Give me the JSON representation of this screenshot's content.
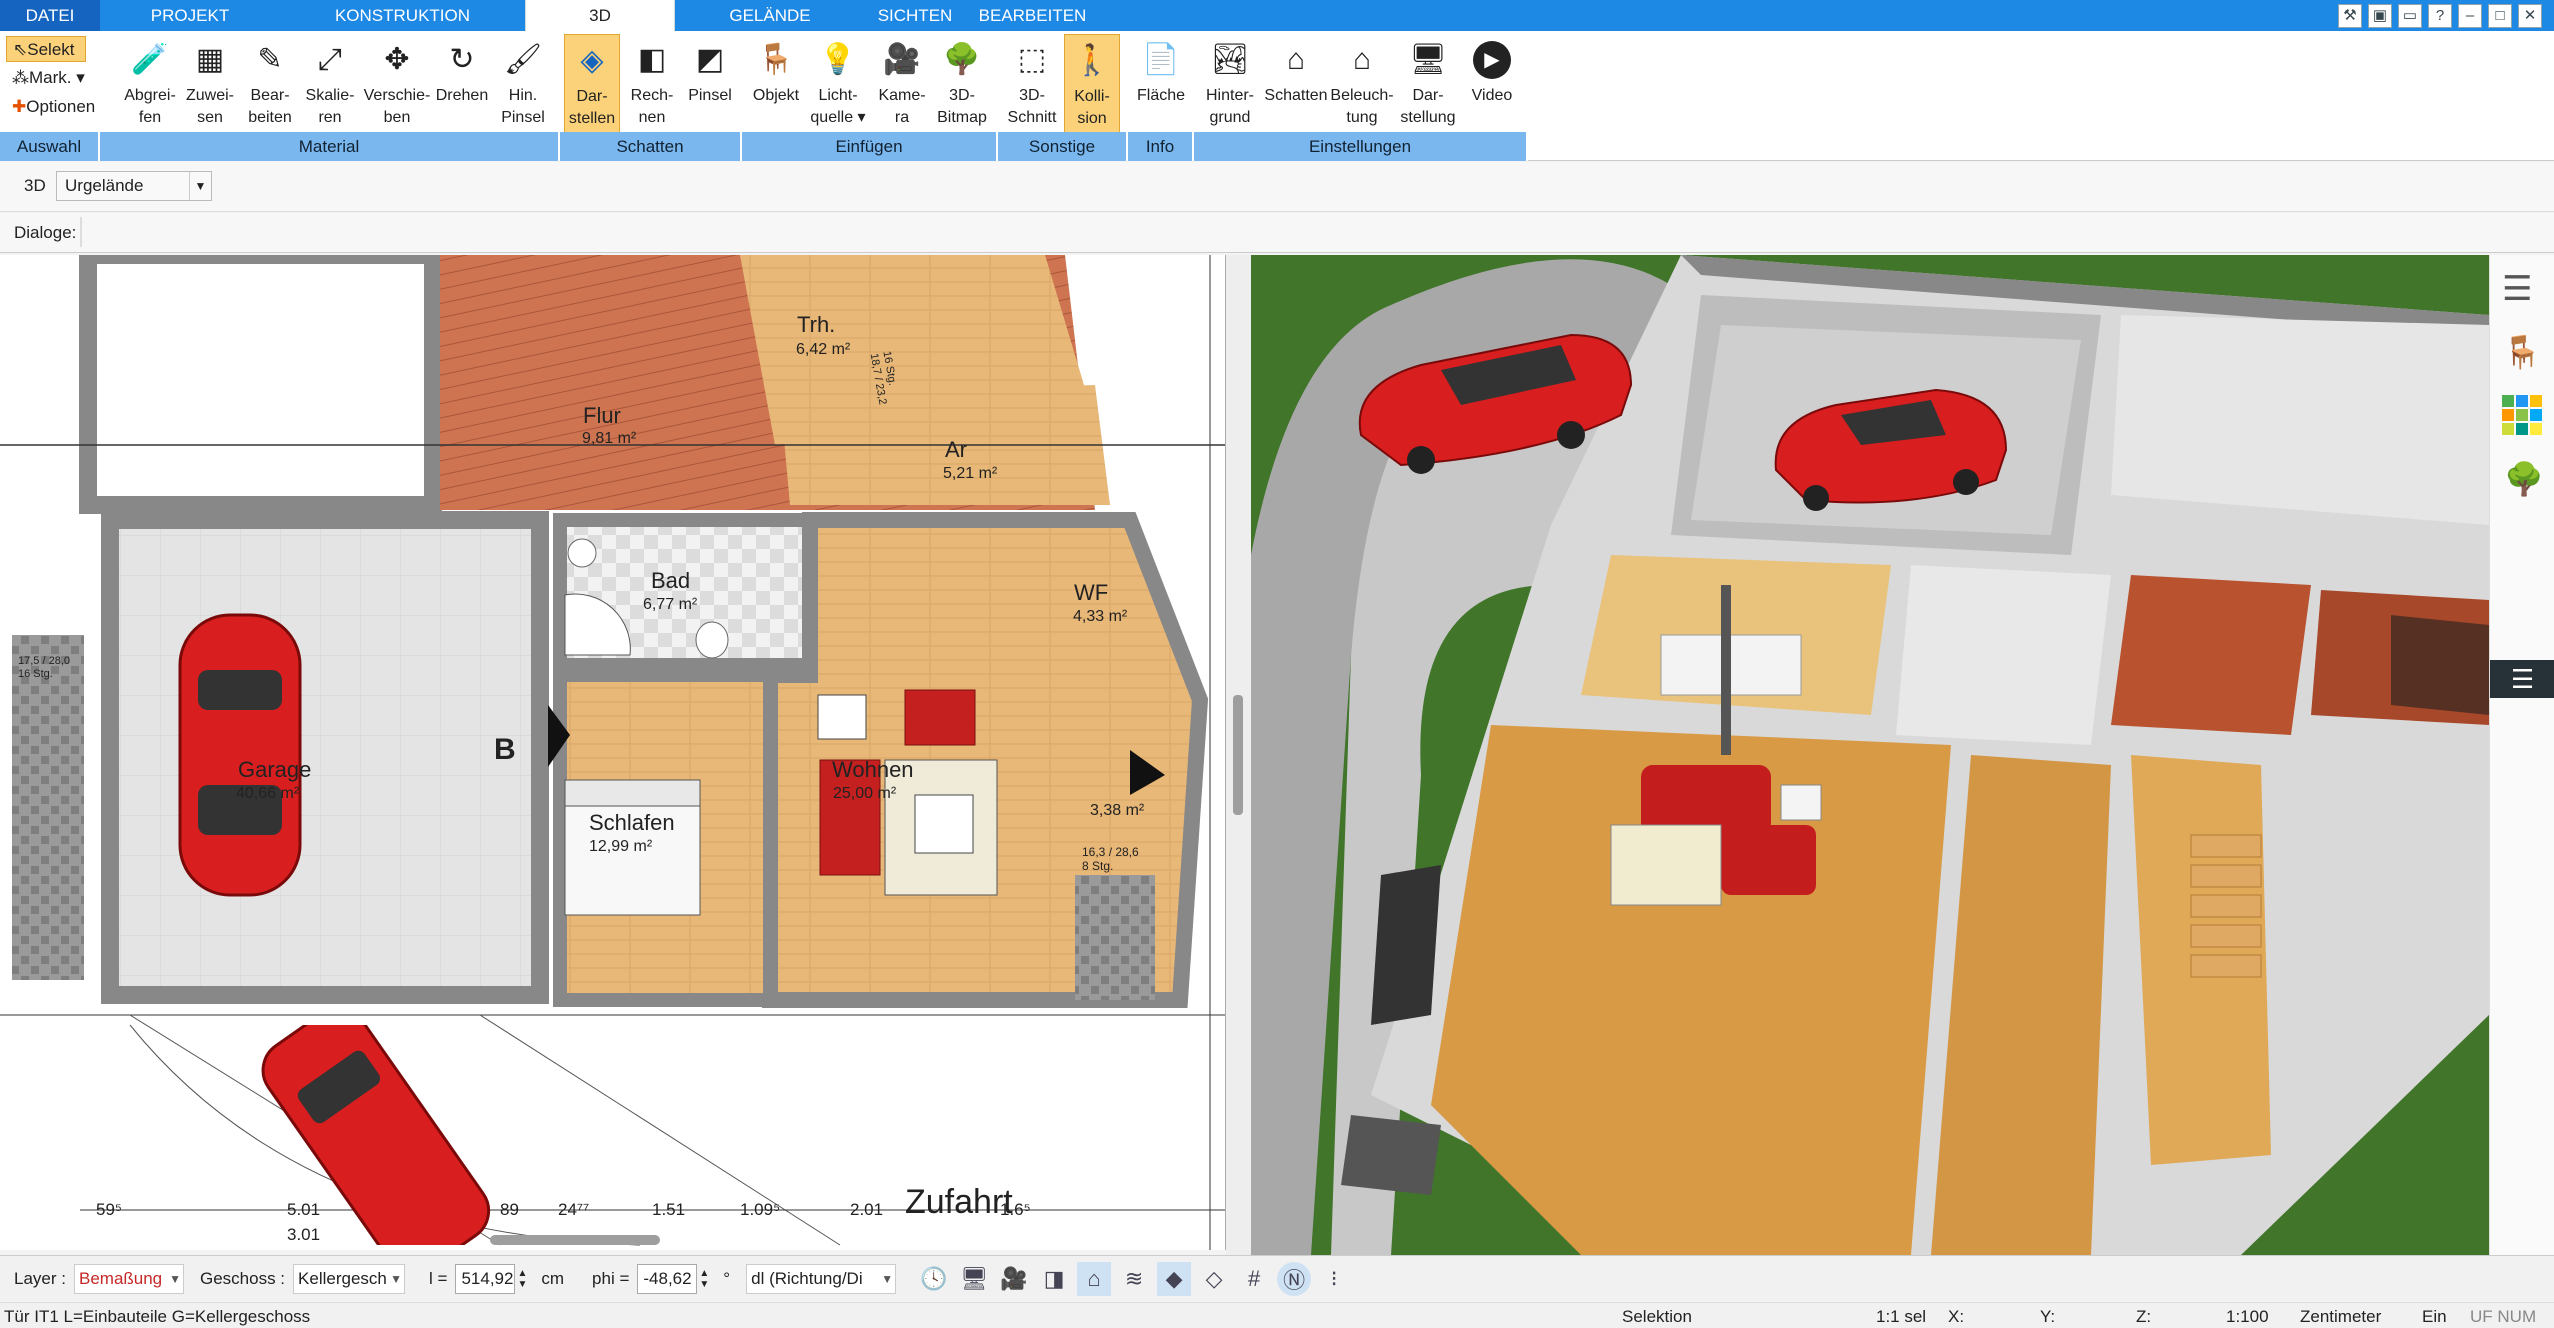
{
  "tabs": [
    "DATEI",
    "PROJEKT",
    "KONSTRUKTION",
    "3D",
    "GELÄNDE",
    "SICHTEN",
    "BEARBEITEN"
  ],
  "ribbon": {
    "auswahl": {
      "caption": "Auswahl",
      "selekt": "Selekt",
      "mark": "Mark.",
      "optionen": "Optionen"
    },
    "material": {
      "caption": "Material",
      "buttons": [
        [
          "Abgrei-",
          "fen"
        ],
        [
          "Zuwei-",
          "sen"
        ],
        [
          "Bear-",
          "beiten"
        ],
        [
          "Skalie-",
          "ren"
        ],
        [
          "Verschie-",
          "ben"
        ],
        [
          "Drehen",
          ""
        ],
        [
          "Hin.",
          "Pinsel"
        ]
      ]
    },
    "schatten": {
      "caption": "Schatten",
      "buttons": [
        [
          "Dar-",
          "stellen"
        ],
        [
          "Rech-",
          "nen"
        ],
        [
          "Pinsel",
          ""
        ]
      ]
    },
    "einfuegen": {
      "caption": "Einfügen",
      "buttons": [
        [
          "Objekt",
          ""
        ],
        [
          "Licht-",
          "quelle"
        ],
        [
          "Kame-",
          "ra"
        ],
        [
          "3D-",
          "Bitmap"
        ]
      ]
    },
    "sonstige": {
      "caption": "Sonstige",
      "buttons": [
        [
          "3D-",
          "Schnitt"
        ],
        [
          "Kolli-",
          "sion"
        ]
      ]
    },
    "info": {
      "caption": "Info",
      "buttons": [
        [
          "Fläche",
          ""
        ]
      ]
    },
    "einstellungen": {
      "caption": "Einstellungen",
      "buttons": [
        [
          "Hinter-",
          "grund"
        ],
        [
          "Schatten",
          ""
        ],
        [
          "Beleuch-",
          "tung"
        ],
        [
          "Dar-",
          "stellung"
        ],
        [
          "Video",
          ""
        ]
      ]
    }
  },
  "optbar": {
    "mode": "3D",
    "layer": "Urgelände"
  },
  "dialoge": "Dialoge:",
  "plan": {
    "rooms": [
      {
        "name": "Flur",
        "area": "9,81 m²"
      },
      {
        "name": "Trh.",
        "area": "6,42 m²"
      },
      {
        "name": "Ar",
        "area": "5,21 m²"
      },
      {
        "name": "Bad",
        "area": "6,77 m²"
      },
      {
        "name": "WF",
        "area": "4,33 m²"
      },
      {
        "name": "Garage",
        "area": "40,66 m²"
      },
      {
        "name": "Wohnen",
        "area": "25,00 m²"
      },
      {
        "name": "Schlafen",
        "area": "12,99 m²"
      },
      {
        "name": "",
        "area": "3,38 m²"
      }
    ],
    "section_mark": "B",
    "stair_left": [
      "17,5 / 28,0",
      "16 Stg."
    ],
    "stair_right": [
      "16,3 / 28,6",
      "8 Stg."
    ],
    "stair_top": [
      "16 Stg.",
      "18,7 / 23,2"
    ],
    "road": "Zufahrt",
    "dims": [
      "59⁵",
      "5.01",
      "89",
      "24⁷⁷",
      "1.51",
      "1.09⁵",
      "2.01",
      "1.6⁵",
      "3.01"
    ]
  },
  "bottom": {
    "layer_label": "Layer :",
    "layer_value": "Bemaßung",
    "geschoss_label": "Geschoss :",
    "geschoss_value": "Kellergesch",
    "l_label": "l =",
    "l_value": "514,92",
    "l_unit": "cm",
    "phi_label": "phi =",
    "phi_value": "-48,62",
    "phi_unit": "°",
    "dl_value": "dl (Richtung/Di"
  },
  "status": {
    "left": "Tür IT1 L=Einbauteile G=Kellergeschoss",
    "mode": "Selektion",
    "sel": "1:1 sel",
    "x": "X:",
    "y": "Y:",
    "z": "Z:",
    "scale": "1:100",
    "unit": "Zentimeter",
    "ein": "Ein",
    "flags": "UF NUM RF"
  },
  "colors": {
    "accent": "#1e88e5",
    "ribbon_group": "#7ab7ee",
    "active_button": "#fbd27a",
    "car": "#d81e1e",
    "layer_value": "#c62828"
  }
}
